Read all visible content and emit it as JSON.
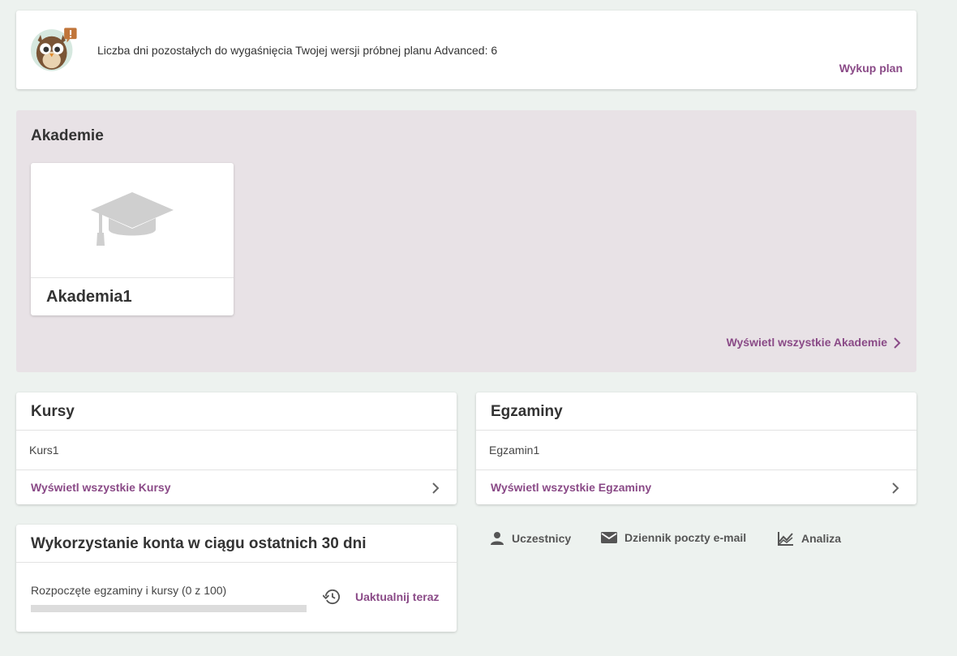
{
  "trial": {
    "message": "Liczba dni pozostałych do wygaśnięcia Twojej wersji próbnej planu Advanced: 6",
    "buy_label": "Wykup plan"
  },
  "academies": {
    "title": "Akademie",
    "items": [
      {
        "name": "Akademia1"
      }
    ],
    "view_all_label": "Wyświetl wszystkie Akademie"
  },
  "courses": {
    "title": "Kursy",
    "items": [
      "Kurs1"
    ],
    "view_all_label": "Wyświetl wszystkie Kursy"
  },
  "exams": {
    "title": "Egzaminy",
    "items": [
      "Egzamin1"
    ],
    "view_all_label": "Wyświetl wszystkie Egzaminy"
  },
  "usage": {
    "title": "Wykorzystanie konta w ciągu ostatnich 30 dni",
    "label": "Rozpoczęte egzaminy i kursy (0 z 100)",
    "used": 0,
    "limit": 100,
    "update_label": "Uaktualnij teraz"
  },
  "quick_links": {
    "participants": "Uczestnicy",
    "email_log": "Dziennik poczty e-mail",
    "analytics": "Analiza"
  },
  "colors": {
    "accent": "#8a4a87",
    "background": "#edf2ef",
    "academies_bg": "#e8e2e6"
  }
}
